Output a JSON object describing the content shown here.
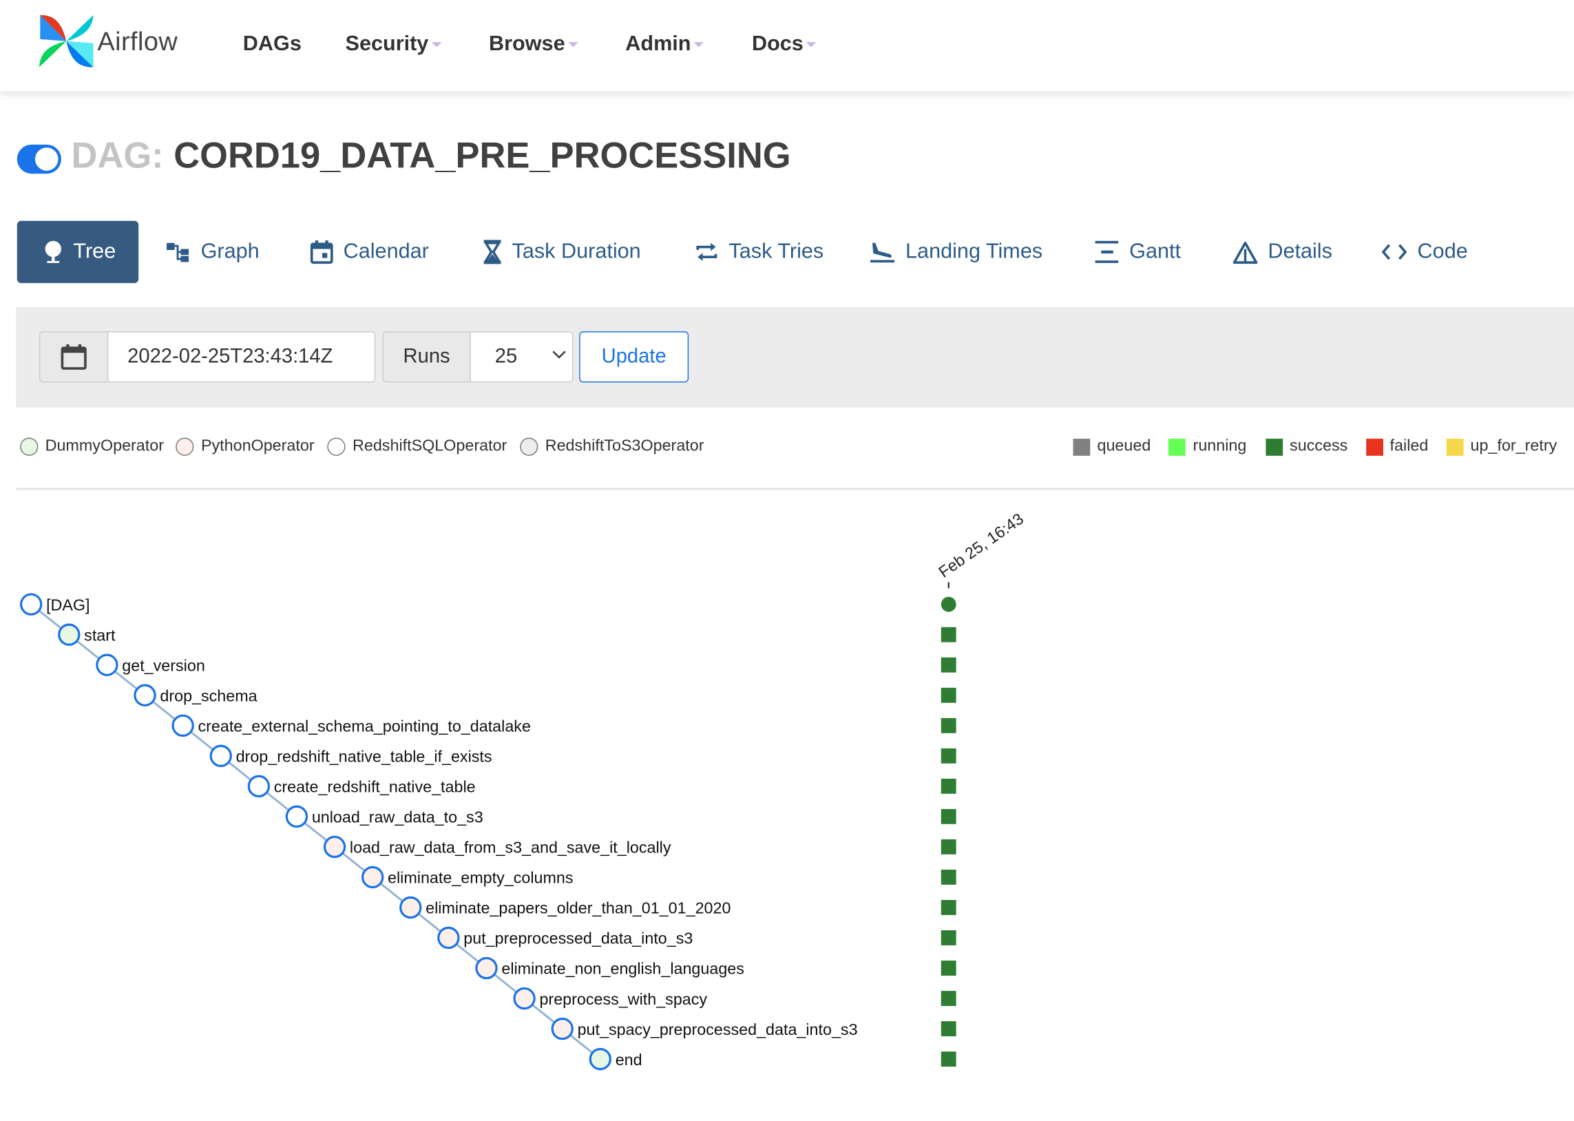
{
  "brand": {
    "name": "Airflow"
  },
  "nav": [
    {
      "label": "DAGs",
      "dropdown": false
    },
    {
      "label": "Security",
      "dropdown": true
    },
    {
      "label": "Browse",
      "dropdown": true
    },
    {
      "label": "Admin",
      "dropdown": true
    },
    {
      "label": "Docs",
      "dropdown": true
    }
  ],
  "dag": {
    "prefix": "DAG:",
    "id": "CORD19_DATA_PRE_PROCESSING",
    "paused": false
  },
  "tabs": [
    {
      "label": "Tree",
      "icon": "tree-icon",
      "active": true
    },
    {
      "label": "Graph",
      "icon": "graph-icon"
    },
    {
      "label": "Calendar",
      "icon": "calendar-icon"
    },
    {
      "label": "Task Duration",
      "icon": "hourglass-icon"
    },
    {
      "label": "Task Tries",
      "icon": "retry-icon"
    },
    {
      "label": "Landing Times",
      "icon": "plane-landing-icon"
    },
    {
      "label": "Gantt",
      "icon": "gantt-icon"
    },
    {
      "label": "Details",
      "icon": "warning-triangle-icon"
    },
    {
      "label": "Code",
      "icon": "code-icon"
    }
  ],
  "controls": {
    "base_date": "2022-02-25T23:43:14Z",
    "runs_label": "Runs",
    "runs_value": "25",
    "update_label": "Update"
  },
  "operators": [
    {
      "name": "DummyOperator",
      "color": "#e8f7e4"
    },
    {
      "name": "PythonOperator",
      "color": "#ffefeb"
    },
    {
      "name": "RedshiftSQLOperator",
      "color": "#ffffff"
    },
    {
      "name": "RedshiftToS3Operator",
      "color": "#ededed"
    }
  ],
  "states": [
    {
      "name": "queued",
      "color": "#808080"
    },
    {
      "name": "running",
      "color": "#66ff55"
    },
    {
      "name": "success",
      "color": "#2e7d32"
    },
    {
      "name": "failed",
      "color": "#e8331e"
    },
    {
      "name": "up_for_retry",
      "color": "#f7d74a"
    }
  ],
  "run_date_label": "Feb 25, 16:43",
  "tasks": [
    {
      "label": "[DAG]",
      "operator": "DAG",
      "state": "success"
    },
    {
      "label": "start",
      "operator": "DummyOperator",
      "state": "success"
    },
    {
      "label": "get_version",
      "operator": "RedshiftSQLOperator",
      "state": "success"
    },
    {
      "label": "drop_schema",
      "operator": "RedshiftSQLOperator",
      "state": "success"
    },
    {
      "label": "create_external_schema_pointing_to_datalake",
      "operator": "RedshiftSQLOperator",
      "state": "success"
    },
    {
      "label": "drop_redshift_native_table_if_exists",
      "operator": "RedshiftSQLOperator",
      "state": "success"
    },
    {
      "label": "create_redshift_native_table",
      "operator": "RedshiftSQLOperator",
      "state": "success"
    },
    {
      "label": "unload_raw_data_to_s3",
      "operator": "RedshiftSQLOperator",
      "state": "success"
    },
    {
      "label": "load_raw_data_from_s3_and_save_it_locally",
      "operator": "PythonOperator",
      "state": "success"
    },
    {
      "label": "eliminate_empty_columns",
      "operator": "PythonOperator",
      "state": "success"
    },
    {
      "label": "eliminate_papers_older_than_01_01_2020",
      "operator": "PythonOperator",
      "state": "success"
    },
    {
      "label": "put_preprocessed_data_into_s3",
      "operator": "PythonOperator",
      "state": "success"
    },
    {
      "label": "eliminate_non_english_languages",
      "operator": "PythonOperator",
      "state": "success"
    },
    {
      "label": "preprocess_with_spacy",
      "operator": "PythonOperator",
      "state": "success"
    },
    {
      "label": "put_spacy_preprocessed_data_into_s3",
      "operator": "PythonOperator",
      "state": "success"
    },
    {
      "label": "end",
      "operator": "DummyOperator",
      "state": "success"
    }
  ]
}
